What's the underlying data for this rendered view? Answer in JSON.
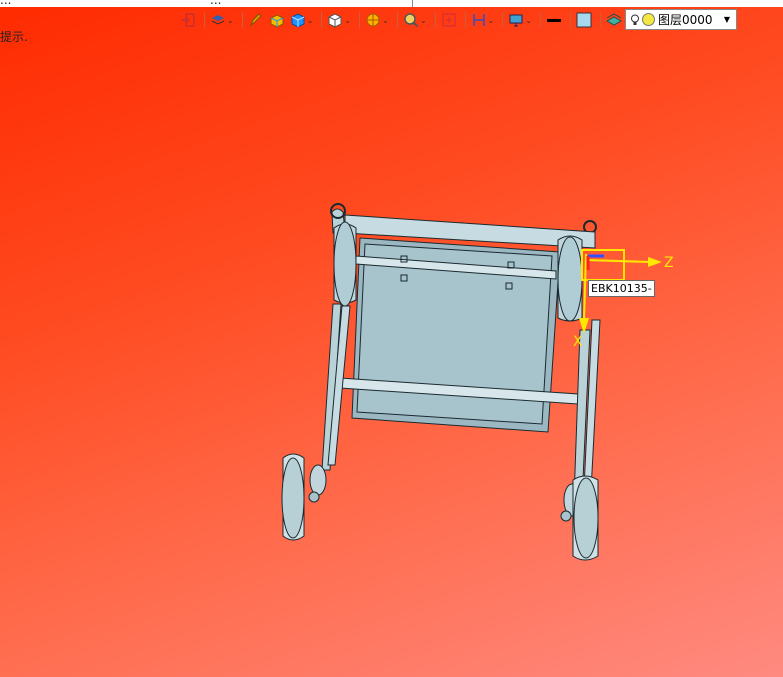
{
  "title_bar": {
    "left_text": "...",
    "tab_text": "..."
  },
  "hint_text": "提示.",
  "toolbar": {
    "items": [
      {
        "name": "exit-icon",
        "color": "#cc3030"
      },
      {
        "name": "layer-view-icon",
        "color": "#3060b0"
      },
      {
        "name": "pencil-icon",
        "color": "#e0a000"
      },
      {
        "name": "box-color-icon",
        "color": "#f0c000"
      },
      {
        "name": "cube-blue-icon",
        "color": "#1e90ff"
      },
      {
        "name": "cube-white-icon",
        "color": "#ffffff"
      },
      {
        "name": "section-icon",
        "color": "#ffb000"
      },
      {
        "name": "zoom-icon",
        "color": "#f0d060"
      },
      {
        "name": "fit-icon",
        "color": "#e03030"
      },
      {
        "name": "ruler-icon",
        "color": "#3050c0"
      },
      {
        "name": "monitor-icon",
        "color": "#40a0d0"
      },
      {
        "name": "line-color-icon",
        "color": "#000000"
      },
      {
        "name": "fill-color-icon",
        "color": "#a8d8f0"
      },
      {
        "name": "layers-stack-icon",
        "color": "#40b0a0"
      }
    ]
  },
  "layer_select": {
    "value": "图层0000"
  },
  "viewport": {
    "part_label": "EBK10135-",
    "axis_z": "Z",
    "axis_x": "X",
    "background_top": "#ff2a00",
    "background_bottom": "#ff8a80",
    "part_color": "#a7c3cc"
  }
}
